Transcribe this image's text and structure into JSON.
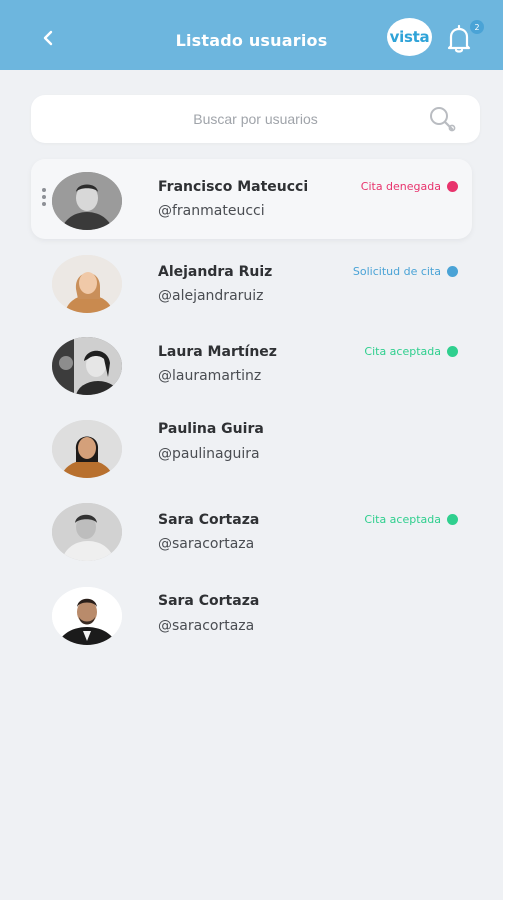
{
  "header": {
    "title": "Listado usuarios",
    "logo_text": "vista",
    "notification_count": "2",
    "background": "#6db6de"
  },
  "search": {
    "placeholder": "Buscar por usuarios"
  },
  "users": [
    {
      "name": "Francisco Mateucci",
      "handle": "@franmateucci",
      "status": "Cita denegada",
      "status_color": "#e8336d"
    },
    {
      "name": "Alejandra Ruiz",
      "handle": "@alejandraruiz",
      "status": "Solicitud de cita",
      "status_color": "#4aa3d6"
    },
    {
      "name": "Laura Martínez",
      "handle": "@lauramartinz",
      "status": "Cita aceptada",
      "status_color": "#2fcf8e"
    },
    {
      "name": "Paulina Guira",
      "handle": "@paulinaguira",
      "status": "",
      "status_color": ""
    },
    {
      "name": "Sara Cortaza",
      "handle": "@saracortaza",
      "status": "Cita aceptada",
      "status_color": "#2fcf8e"
    },
    {
      "name": "Sara Cortaza",
      "handle": "@saracortaza",
      "status": "",
      "status_color": ""
    }
  ]
}
